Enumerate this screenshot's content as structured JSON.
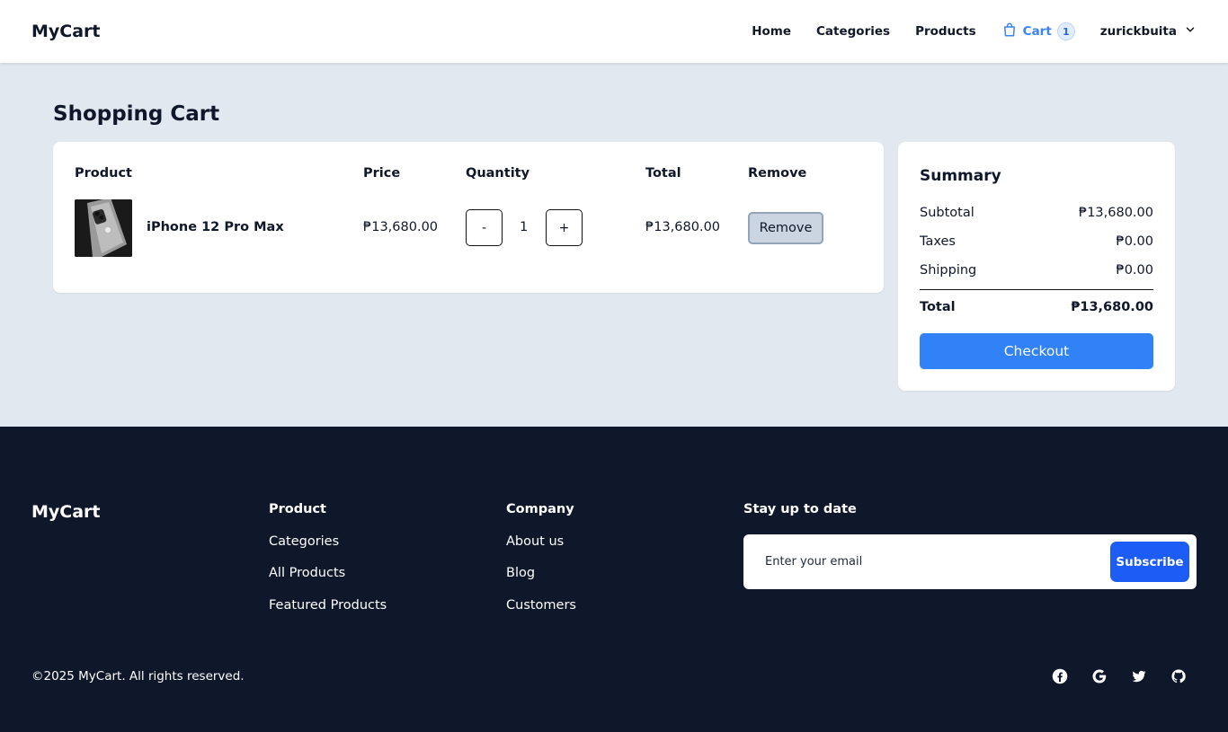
{
  "header": {
    "brand": "MyCart",
    "nav": {
      "home": "Home",
      "categories": "Categories",
      "products": "Products",
      "cart": "Cart",
      "cart_count": "1",
      "user": "zurickbuita"
    }
  },
  "main": {
    "title": "Shopping Cart",
    "columns": {
      "product": "Product",
      "price": "Price",
      "quantity": "Quantity",
      "total": "Total",
      "remove": "Remove"
    },
    "items": [
      {
        "name": "iPhone 12 Pro Max",
        "price": "₱13,680.00",
        "decrement": "-",
        "quantity": "1",
        "increment": "+",
        "total": "₱13,680.00",
        "remove": "Remove"
      }
    ]
  },
  "summary": {
    "title": "Summary",
    "subtotal_label": "Subtotal",
    "subtotal": "₱13,680.00",
    "taxes_label": "Taxes",
    "taxes": "₱0.00",
    "shipping_label": "Shipping",
    "shipping": "₱0.00",
    "total_label": "Total",
    "total": "₱13,680.00",
    "checkout": "Checkout"
  },
  "footer": {
    "brand": "MyCart",
    "product": {
      "title": "Product",
      "links": [
        "Categories",
        "All Products",
        "Featured Products"
      ]
    },
    "company": {
      "title": "Company",
      "links": [
        "About us",
        "Blog",
        "Customers"
      ]
    },
    "newsletter": {
      "title": "Stay up to date",
      "placeholder": "Enter your email",
      "button": "Subscribe"
    },
    "copyright": "©2025 MyCart. All rights reserved.",
    "socials": [
      "facebook-icon",
      "google-icon",
      "twitter-icon",
      "github-icon"
    ]
  },
  "colors": {
    "accent": "#3182f6",
    "subscribe": "#1d5cf5",
    "page_bg": "#e2e8f0",
    "footer_bg": "#0f172a"
  }
}
